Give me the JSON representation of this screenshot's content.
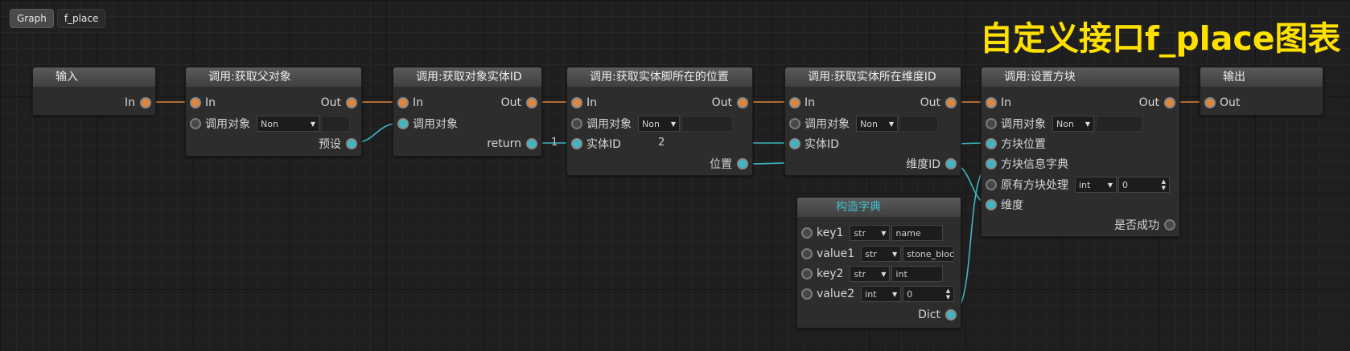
{
  "breadcrumb": [
    "Graph",
    "f_place"
  ],
  "title": "自定义接口f_place图表",
  "colors": {
    "exec": "#e0853a",
    "data": "#3fb6c4",
    "title": "#ffe100"
  },
  "nodes": {
    "input": {
      "title": "输入",
      "out": "In"
    },
    "get_parent": {
      "title": "调用:获取父对象",
      "in": "In",
      "out": "Out",
      "target": "调用对象",
      "target_value": "Non",
      "preset": "预设"
    },
    "get_entity_id": {
      "title": "调用:获取对象实体ID",
      "in": "In",
      "out": "Out",
      "target": "调用对象",
      "return": "return"
    },
    "get_foot_pos": {
      "title": "调用:获取实体脚所在的位置",
      "in": "In",
      "out": "Out",
      "target": "调用对象",
      "target_value": "Non",
      "entity_id": "实体ID",
      "position": "位置"
    },
    "get_dim_id": {
      "title": "调用:获取实体所在维度ID",
      "in": "In",
      "out": "Out",
      "target": "调用对象",
      "target_value": "Non",
      "entity_id": "实体ID",
      "dim_id": "维度ID"
    },
    "set_block": {
      "title": "调用:设置方块",
      "in": "In",
      "out": "Out",
      "target": "调用对象",
      "target_value": "Non",
      "block_pos": "方块位置",
      "block_dict": "方块信息字典",
      "old_handling": "原有方块处理",
      "old_type": "int",
      "old_value": "0",
      "dimension": "维度",
      "success": "是否成功"
    },
    "output": {
      "title": "输出",
      "in": "Out"
    },
    "build_dict": {
      "title": "构造字典",
      "key1": "key1",
      "key1_type": "str",
      "key1_value": "name",
      "value1": "value1",
      "value1_type": "str",
      "value1_value": "stone_block",
      "key2": "key2",
      "key2_type": "str",
      "key2_value": "int",
      "value2": "value2",
      "value2_type": "int",
      "value2_value": "0",
      "out": "Dict"
    }
  },
  "link_labels": {
    "one": "1",
    "two": "2"
  }
}
